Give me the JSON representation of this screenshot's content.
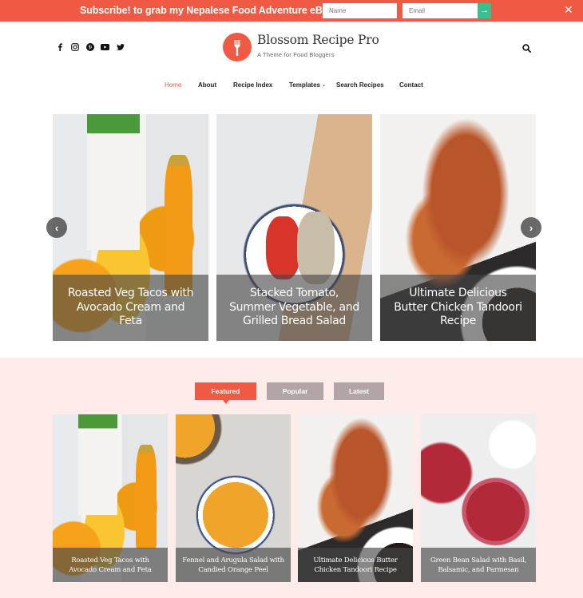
{
  "topbar": {
    "promo_text": "Subscribe! to grab my Nepalese Food Adventure eBook!",
    "name_placeholder": "Name",
    "email_placeholder": "Email",
    "submit_icon": "arrow-right-icon",
    "close_icon": "close-icon",
    "bar_color": "#f05a45",
    "submit_color": "#3cbf8e"
  },
  "header": {
    "social_icons": [
      "facebook-icon",
      "instagram-icon",
      "pinterest-icon",
      "youtube-icon",
      "twitter-icon"
    ],
    "site_title": "Blossom Recipe Pro",
    "tagline": "A Theme for Food Bloggers",
    "logo_icon": "fork-icon",
    "search_icon": "search-icon",
    "accent_color": "#f05a45"
  },
  "nav": {
    "items": [
      {
        "label": "Home",
        "active": true
      },
      {
        "label": "About"
      },
      {
        "label": "Recipe Index"
      },
      {
        "label": "Templates",
        "has_dropdown": true
      },
      {
        "label": "Search Recipes"
      },
      {
        "label": "Contact"
      }
    ]
  },
  "slider": {
    "prev_label": "‹",
    "next_label": "›",
    "slides": [
      {
        "title": "Roasted Veg Tacos with Avocado Cream and Feta"
      },
      {
        "title": "Stacked Tomato, Summer Vegetable, and Grilled Bread Salad"
      },
      {
        "title": "Ultimate Delicious Butter Chicken Tandoori Recipe"
      }
    ]
  },
  "tabs": {
    "items": [
      {
        "label": "Featured",
        "active": true
      },
      {
        "label": "Popular"
      },
      {
        "label": "Latest"
      }
    ]
  },
  "featured": {
    "posts": [
      {
        "title": "Roasted Veg Tacos with Avocado Cream and Feta"
      },
      {
        "title": "Fennel and Arugula Salad with Candied Orange Peel"
      },
      {
        "title": "Ultimate Delicious Butter Chicken Tandoori Recipe"
      },
      {
        "title": "Green Bean Salad with Basil, Balsamic, and Parmesan"
      }
    ]
  }
}
